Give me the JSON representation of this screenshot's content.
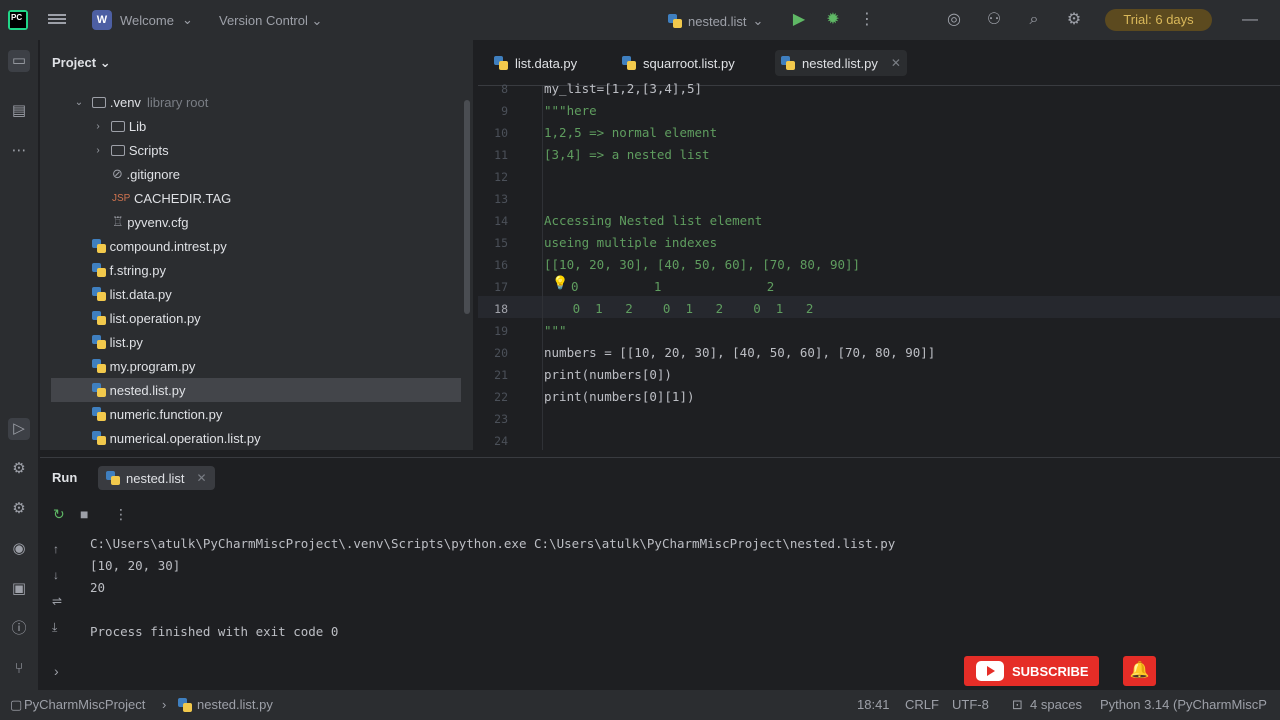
{
  "titlebar": {
    "project_badge": "W",
    "project_name": "Welcome",
    "version_control": "Version Control",
    "run_config": "nested.list",
    "trial": "Trial: 6 days"
  },
  "project_panel": {
    "title": "Project",
    "items": [
      {
        "label": ".venv",
        "hint": "library root",
        "kind": "folder-open"
      },
      {
        "label": "Lib",
        "kind": "folder"
      },
      {
        "label": "Scripts",
        "kind": "folder"
      },
      {
        "label": ".gitignore",
        "kind": "ignore"
      },
      {
        "label": "CACHEDIR.TAG",
        "kind": "tag"
      },
      {
        "label": "pyvenv.cfg",
        "kind": "cfg"
      },
      {
        "label": "compound.intrest.py",
        "kind": "py"
      },
      {
        "label": "f.string.py",
        "kind": "py"
      },
      {
        "label": "list.data.py",
        "kind": "py"
      },
      {
        "label": "list.operation.py",
        "kind": "py"
      },
      {
        "label": "list.py",
        "kind": "py"
      },
      {
        "label": "my.program.py",
        "kind": "py"
      },
      {
        "label": "nested.list.py",
        "kind": "py",
        "selected": true
      },
      {
        "label": "numeric.function.py",
        "kind": "py"
      },
      {
        "label": "numerical.operation.list.py",
        "kind": "py"
      }
    ]
  },
  "editor": {
    "tabs": [
      "list.data.py",
      "squarroot.list.py",
      "nested.list.py"
    ],
    "lines": [
      {
        "n": "8",
        "text": "my_list=[1,2,[3,4],5]"
      },
      {
        "n": "9",
        "text": "\"\"\"here"
      },
      {
        "n": "10",
        "text": "1,2,5 => normal element"
      },
      {
        "n": "11",
        "text": "[3,4] => a nested list"
      },
      {
        "n": "12",
        "text": ""
      },
      {
        "n": "13",
        "text": ""
      },
      {
        "n": "14",
        "text": "Accessing Nested list element"
      },
      {
        "n": "15",
        "text": "useing multiple indexes"
      },
      {
        "n": "16",
        "text": "[[10, 20, 30], [40, 50, 60], [70, 80, 90]]"
      },
      {
        "n": "17",
        "text": "  0          1              2"
      },
      {
        "n": "18",
        "text": "   0  1   2    0  1   2    0  1   2"
      },
      {
        "n": "19",
        "text": "\"\"\""
      },
      {
        "n": "20",
        "text": "numbers = [[10, 20, 30], [40, 50, 60], [70, 80, 90]]"
      },
      {
        "n": "21",
        "text": "print(numbers[0])"
      },
      {
        "n": "22",
        "text": "print(numbers[0][1])"
      },
      {
        "n": "23",
        "text": ""
      },
      {
        "n": "24",
        "text": ""
      }
    ]
  },
  "run": {
    "title": "Run",
    "tab": "nested.list",
    "output": [
      "C:\\Users\\atulk\\PyCharmMiscProject\\.venv\\Scripts\\python.exe C:\\Users\\atulk\\PyCharmMiscProject\\nested.list.py",
      "[10, 20, 30]",
      "20",
      "",
      "Process finished with exit code 0"
    ]
  },
  "statusbar": {
    "project": "PyCharmMiscProject",
    "file": "nested.list.py",
    "position": "18:41",
    "line_ending": "CRLF",
    "encoding": "UTF-8",
    "indent": "4 spaces",
    "interpreter": "Python 3.14 (PyCharmMiscP"
  },
  "overlay": {
    "subscribe": "SUBSCRIBE"
  }
}
